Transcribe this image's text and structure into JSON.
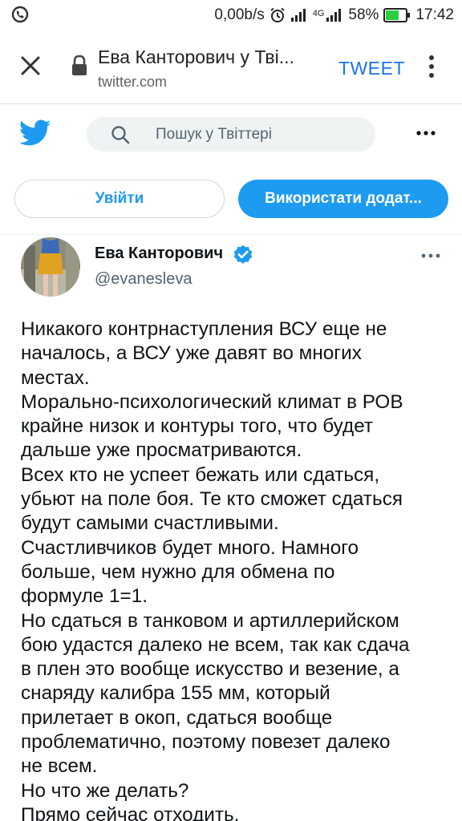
{
  "status_bar": {
    "net_speed": "0,00b/s",
    "network_label": "4G",
    "battery": "58%",
    "time": "17:42"
  },
  "browser": {
    "page_title": "Ева Канторович у Тві...",
    "url": "twitter.com",
    "action_label": "TWEET"
  },
  "twitter": {
    "search_placeholder": "Пошук у Твіттері",
    "login_label": "Увійти",
    "app_label": "Використати додат..."
  },
  "tweet": {
    "author_name": "Ева Канторович",
    "author_handle": "@evanesleva",
    "lines": [
      "Никакого контрнаступления ВСУ еще не",
      "началось, а ВСУ уже давят во многих",
      "местах.",
      "Морально-психологический климат в РОВ",
      "крайне низок и контуры того, что будет",
      "дальше уже просматриваются.",
      "Всех кто не успеет бежать или сдаться,",
      "убьют на поле боя. Те кто сможет сдаться",
      "будут самыми счастливыми.",
      "Счастливчиков будет много. Намного",
      "больше, чем нужно для обмена по",
      "формуле 1=1.",
      "Но сдаться в танковом и артиллерийском",
      "бою удастся далеко не всем, так как сдача",
      "в плен это вообще искусство и везение, а",
      "снаряду калибра 155 мм, который",
      "прилетает в окоп, сдаться вообще",
      "проблематично, поэтому повезет далеко",
      "не всем.",
      "Но что же делать?",
      "Прямо сейчас отходить."
    ]
  },
  "colors": {
    "twitter_blue": "#1d9bf0",
    "chrome_blue": "#1a73e8",
    "text_primary": "#0f1419",
    "text_secondary": "#536471",
    "battery_green": "#2ecc40"
  },
  "icons": [
    "viber-icon",
    "alarm-icon",
    "signal-icon",
    "battery-icon",
    "close-icon",
    "lock-icon",
    "overflow-menu-icon",
    "twitter-bird-icon",
    "search-icon",
    "more-icon",
    "verified-badge-icon"
  ]
}
